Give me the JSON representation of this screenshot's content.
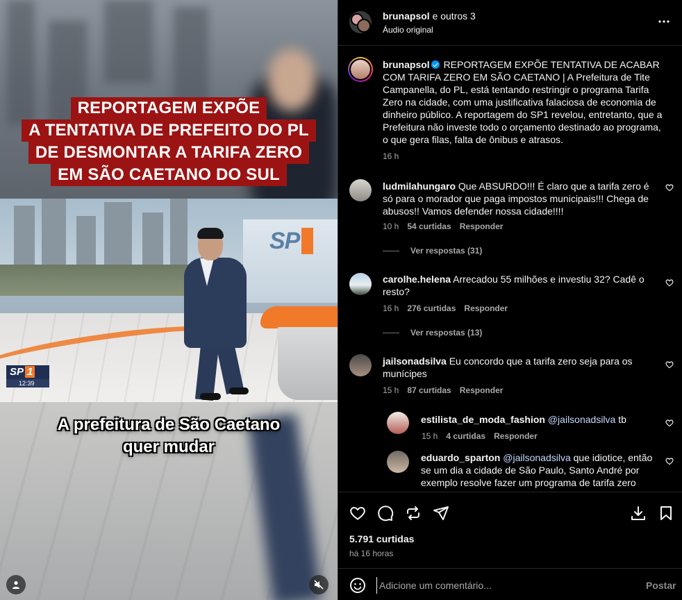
{
  "video": {
    "headline_lines": [
      "REPORTAGEM EXPÕE",
      "A TENTATIVA DE PREFEITO DO PL",
      "DE DESMONTAR A TARIFA ZERO",
      "EM SÃO CAETANO DO SUL"
    ],
    "studio_logo": "SP",
    "badge_channel": "SP",
    "badge_number": "1",
    "badge_time": "12:39",
    "subtitle_lines": [
      "A prefeitura de São Caetano",
      "quer mudar"
    ]
  },
  "header": {
    "username": "brunapsol",
    "collab_text": "e outros 3",
    "audio": "Áudio original"
  },
  "caption": {
    "username": "brunapsol",
    "text": "REPORTAGEM EXPÕE TENTATIVA DE ACABAR COM TARIFA ZERO EM SÃO CAETANO | A Prefeitura de Tite Campanella, do PL, está tentando restringir o programa Tarifa Zero na cidade, com uma justificativa falaciosa de economia de dinheiro público. A reportagem do SP1 revelou, entretanto, que a Prefeitura não investe todo o orçamento destinado ao programa, o que gera filas, falta de ônibus e atrasos.",
    "time": "16 h"
  },
  "comments": [
    {
      "username": "ludmilahungaro",
      "text": "Que ABSURDO!!! É claro que a tarifa zero é só para o morador que paga impostos municipais!!! Chega de abusos!! Vamos defender nossa cidade!!!!",
      "time": "10 h",
      "likes": "54 curtidas",
      "reply": "Responder",
      "view_replies": "Ver respostas (31)"
    },
    {
      "username": "carolhe.helena",
      "text": "Arrecadou 55 milhões e investiu 32? Cadê o resto?",
      "time": "16 h",
      "likes": "276 curtidas",
      "reply": "Responder",
      "view_replies": "Ver respostas (13)"
    },
    {
      "username": "jailsonadsilva",
      "text": "Eu concordo que a tarifa zero seja para os munícipes",
      "time": "15 h",
      "likes": "87 curtidas",
      "reply": "Responder"
    }
  ],
  "replies": [
    {
      "username": "estilista_de_moda_fashion",
      "mention": "@jailsonadsilva",
      "text": "tb",
      "time": "15 h",
      "likes": "4 curtidas",
      "reply": "Responder"
    },
    {
      "username": "eduardo_sparton",
      "mention": "@jailsonadsilva",
      "text": "que idiotice, então se um dia a cidade de São Paulo, Santo André por exemplo resolve fazer um programa de tarifa zero quem mora no SCS não vai poder usufruir. Outra"
    }
  ],
  "actions": {
    "likes": "5.791 curtidas",
    "time_ago": "há 16 horas"
  },
  "footer": {
    "placeholder": "Adicione um comentário...",
    "post_label": "Postar"
  },
  "colors": {
    "accent": "#0095f6",
    "headline_bg": "#9c1313",
    "studio_orange": "#f07a2a"
  }
}
